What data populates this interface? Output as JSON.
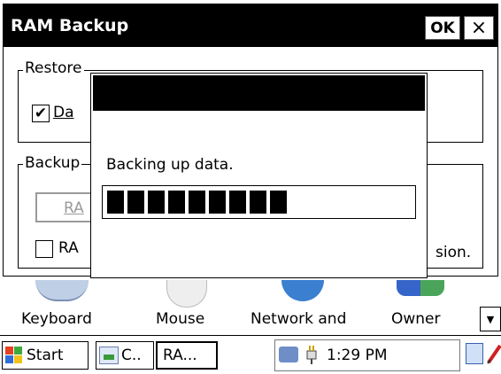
{
  "window": {
    "title": "RAM Backup",
    "ok_label": "OK",
    "close_label": "×",
    "restore_group": {
      "label": "Restore",
      "checkbox_label": "Da",
      "checkbox_checked": true
    },
    "backup_group": {
      "label": "Backup",
      "button_label": "RA",
      "checkbox_label": "RA",
      "checkbox_checked": false,
      "trailing_text": "sion."
    }
  },
  "dialog": {
    "title": "",
    "message": "Backing up data.",
    "progress_filled_segments": 9
  },
  "control_panel": {
    "items": [
      {
        "label": "Keyboard",
        "icon": "keyboard-icon"
      },
      {
        "label": "Mouse",
        "icon": "mouse-icon"
      },
      {
        "label": "Network and",
        "icon": "network-icon"
      },
      {
        "label": "Owner",
        "icon": "owner-icon"
      }
    ],
    "scroll_glyph": "▼"
  },
  "taskbar": {
    "start_label": "Start",
    "tasks": [
      "C..",
      "RA..."
    ],
    "clock": "1:29 PM"
  },
  "colors": {
    "window_title_bg": "#000000",
    "disabled_text": "#9a9a9a"
  }
}
